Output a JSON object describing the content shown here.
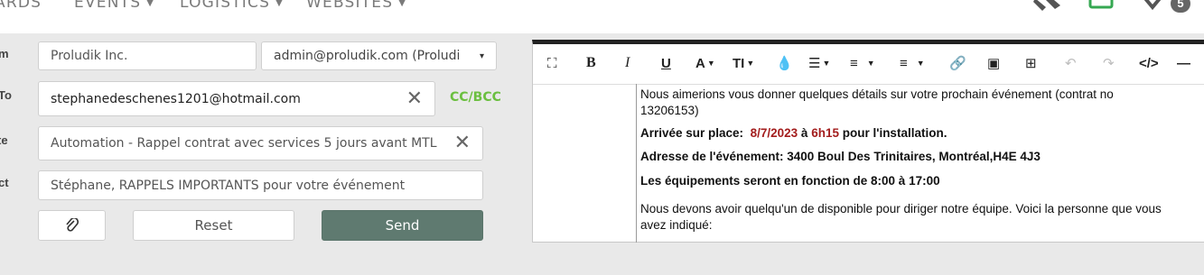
{
  "nav": {
    "items": [
      "ARDS",
      "EVENTS",
      "LOGISTICS",
      "WEBSITES"
    ],
    "badge_count": "5"
  },
  "form": {
    "labels": {
      "from": "m",
      "to": "To",
      "template": "te",
      "subject": "ct"
    },
    "from_value": "Proludik Inc.",
    "sender_select": "admin@proludik.com (Proludi",
    "to_value": "stephanedeschenes1201@hotmail.com",
    "ccbcc": "CC/BCC",
    "template_value": "Automation - Rappel contrat avec services 5 jours avant MTL",
    "subject_value": "Stéphane, RAPPELS IMPORTANTS pour votre événement",
    "reset_label": "Reset",
    "send_label": "Send"
  },
  "editor": {
    "toolbar_icons": [
      "fullscreen-icon",
      "bold-icon",
      "italic-icon",
      "underline-icon",
      "font-color-icon",
      "font-size-icon",
      "highlight-icon",
      "align-icon",
      "ordered-list-icon",
      "unordered-list-icon",
      "link-icon",
      "image-icon",
      "table-icon",
      "undo-icon",
      "redo-icon",
      "code-view-icon",
      "horizontal-rule-icon"
    ],
    "body": {
      "p1": "Nous aimerions vous donner quelques détails sur votre prochain événement (contrat no",
      "p1b": "13206153)",
      "arrival_label": "Arrivée sur place:",
      "arrival_date": "8/7/2023",
      "arrival_at": "à",
      "arrival_time": "6h15",
      "arrival_suffix": "pour l'installation.",
      "address": "Adresse de l'événement: 3400 Boul Des Trinitaires, Montréal,H4E 4J3",
      "equipment": "Les équipements seront en fonction de 8:00 à 17:00",
      "p5": "Nous devons avoir quelqu'un de disponible pour diriger notre équipe. Voici la personne que vous",
      "p5b": "avez indiqué:"
    }
  },
  "colors": {
    "send_button": "#5f7a70",
    "ccbcc": "#6bbf40",
    "highlight_red": "#a31d1d"
  }
}
